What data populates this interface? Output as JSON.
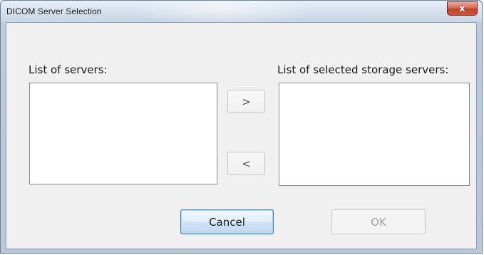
{
  "window": {
    "title": "DICOM Server Selection",
    "close_glyph": "x"
  },
  "dialog": {
    "servers_label": "List of servers:",
    "selected_label": "List of selected storage servers:",
    "servers": [],
    "selected_servers": [],
    "add_button_label": ">",
    "remove_button_label": "<",
    "cancel_button_label": "Cancel",
    "ok_button_label": "OK",
    "ok_enabled": false
  },
  "colors": {
    "close_button": "#c94a32",
    "default_button_border": "#3c7fb1",
    "client_background": "#f0f0f0"
  }
}
